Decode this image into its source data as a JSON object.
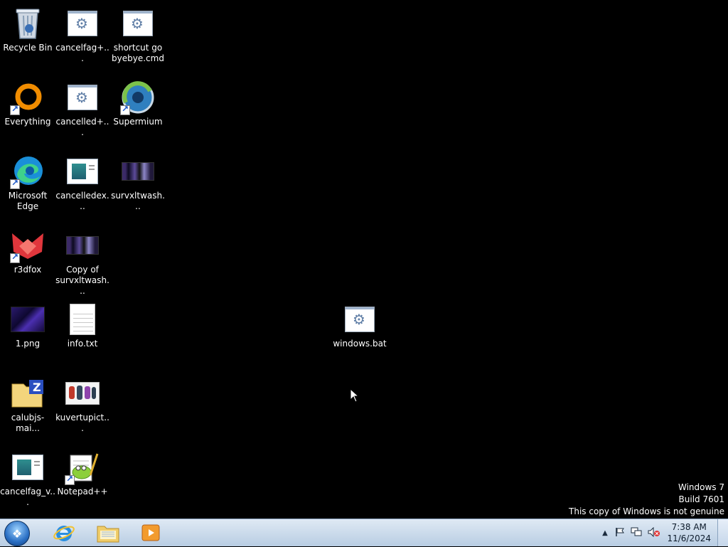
{
  "desktop": {
    "icons": [
      {
        "label": "Recycle Bin"
      },
      {
        "label": "cancelfag+..."
      },
      {
        "label": "shortcut go byebye.cmd"
      },
      {
        "label": "Everything"
      },
      {
        "label": "cancelled+..."
      },
      {
        "label": "Supermium"
      },
      {
        "label": "Microsoft Edge"
      },
      {
        "label": "cancelledex..."
      },
      {
        "label": "survxltwash..."
      },
      {
        "label": "r3dfox"
      },
      {
        "label": "Copy of survxltwash..."
      },
      {
        "label": "1.png"
      },
      {
        "label": "info.txt"
      },
      {
        "label": "windows.bat"
      },
      {
        "label": "calubjs-mai..."
      },
      {
        "label": "kuvertupict..."
      },
      {
        "label": "cancelfag_v..."
      },
      {
        "label": "Notepad++"
      }
    ]
  },
  "watermark": {
    "line1": "Windows 7",
    "line2": "Build 7601",
    "line3": "This copy of Windows is not genuine"
  },
  "taskbar": {
    "pinned": [
      {
        "name": "Internet Explorer",
        "icon": "ie-icon"
      },
      {
        "name": "Windows Explorer",
        "icon": "explorer-folder-icon"
      },
      {
        "name": "Windows Media Player",
        "icon": "media-player-icon"
      }
    ],
    "clock": {
      "time": "7:38 AM",
      "date": "11/6/2024"
    }
  },
  "colors": {
    "desktop_bg": "#000000",
    "taskbar_top": "#dfe9f4",
    "taskbar_bottom": "#b9cde3"
  }
}
